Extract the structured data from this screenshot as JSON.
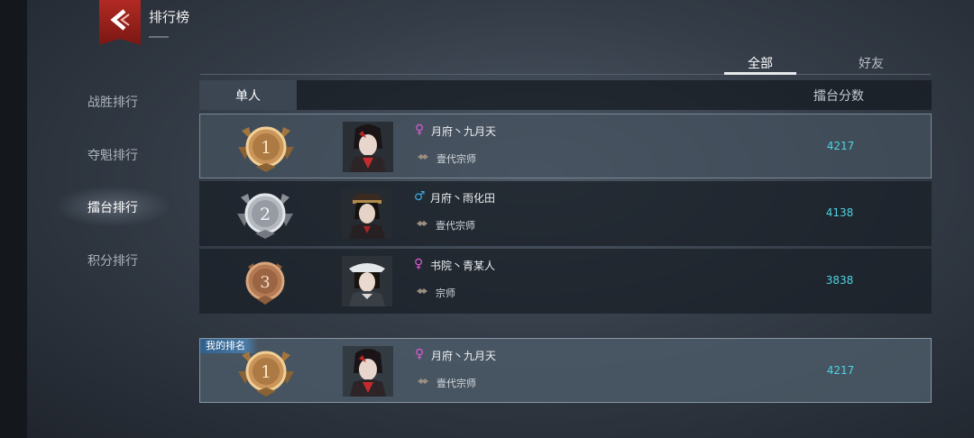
{
  "header": {
    "title": "排行榜",
    "back_icon": "back-arrow-icon",
    "accent": "#b22a24"
  },
  "nav": {
    "items": [
      {
        "label": "战胜排行",
        "active": false
      },
      {
        "label": "夺魁排行",
        "active": false
      },
      {
        "label": "擂台排行",
        "active": true
      },
      {
        "label": "积分排行",
        "active": false
      }
    ]
  },
  "tabs": [
    {
      "label": "全部",
      "active": true
    },
    {
      "label": "好友",
      "active": false
    }
  ],
  "table": {
    "sub_tab": "单人",
    "score_header": "擂台分数",
    "rows": [
      {
        "rank": "1",
        "gender": "♀",
        "name": "月府丶九月天",
        "title": "壹代宗师",
        "score": "4217"
      },
      {
        "rank": "2",
        "gender": "♂",
        "name": "月府丶雨化田",
        "title": "壹代宗师",
        "score": "4138"
      },
      {
        "rank": "3",
        "gender": "♀",
        "name": "书院丶青某人",
        "title": "宗师",
        "score": "3838"
      }
    ]
  },
  "my_rank": {
    "tag": "我的排名",
    "rank": "1",
    "gender": "♀",
    "name": "月府丶九月天",
    "title": "壹代宗师",
    "score": "4217"
  },
  "colors": {
    "score": "#4fd3df",
    "female": "#d85ad6",
    "male": "#3fa9e8"
  }
}
